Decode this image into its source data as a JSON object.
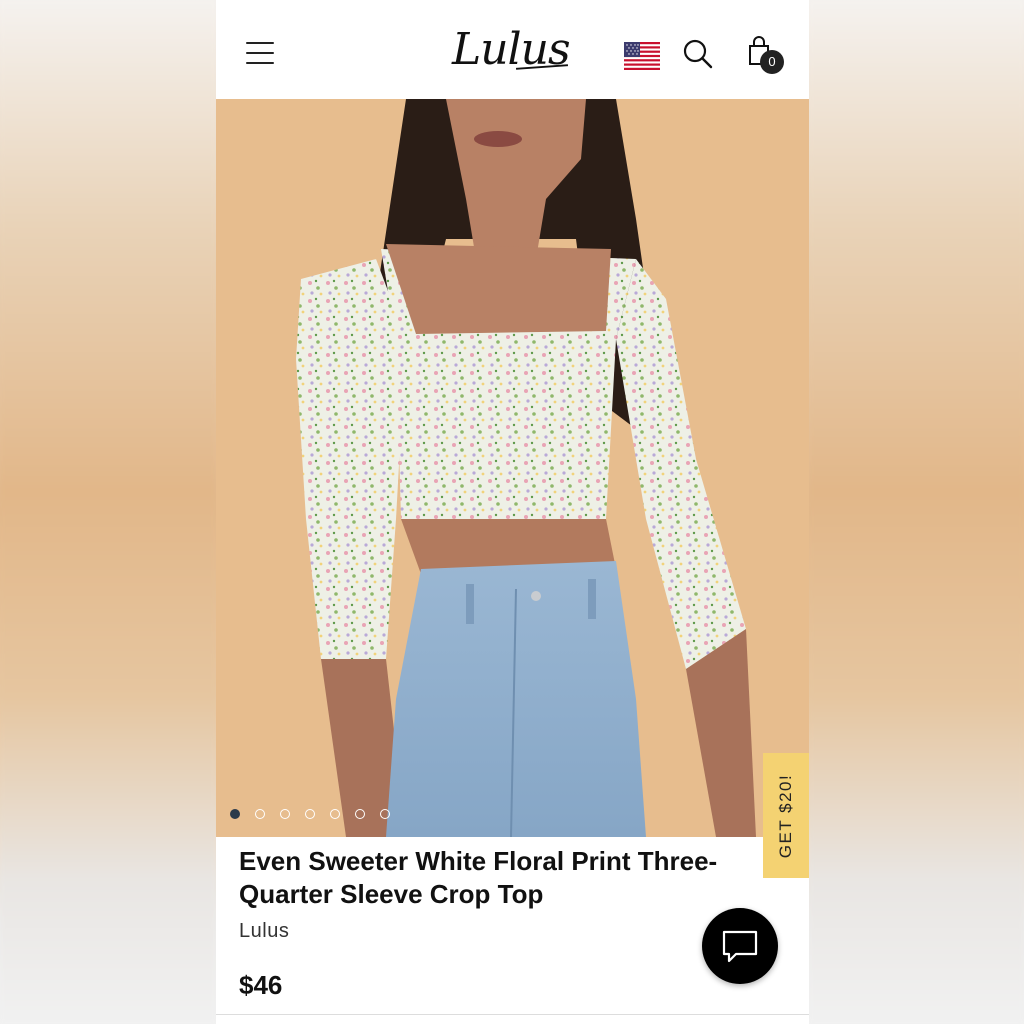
{
  "header": {
    "logo_text": "Lulus",
    "menu_icon": "hamburger-menu-icon",
    "flag_icon": "us-flag-icon",
    "search_icon": "search-icon",
    "cart_icon": "shopping-bag-icon",
    "cart_count": "0"
  },
  "gallery": {
    "image_count": 7,
    "active_index": 0
  },
  "promo": {
    "label": "GET $20!"
  },
  "product": {
    "title": "Even Sweeter White Floral Print Three-Quarter Sleeve Crop Top",
    "brand": "Lulus",
    "price": "$46"
  },
  "chat": {
    "icon": "chat-bubble-icon"
  },
  "colors": {
    "promo_bg": "#f4d272",
    "hero_bg": "#e7bd8e",
    "active_dot": "#2b3a4a"
  }
}
